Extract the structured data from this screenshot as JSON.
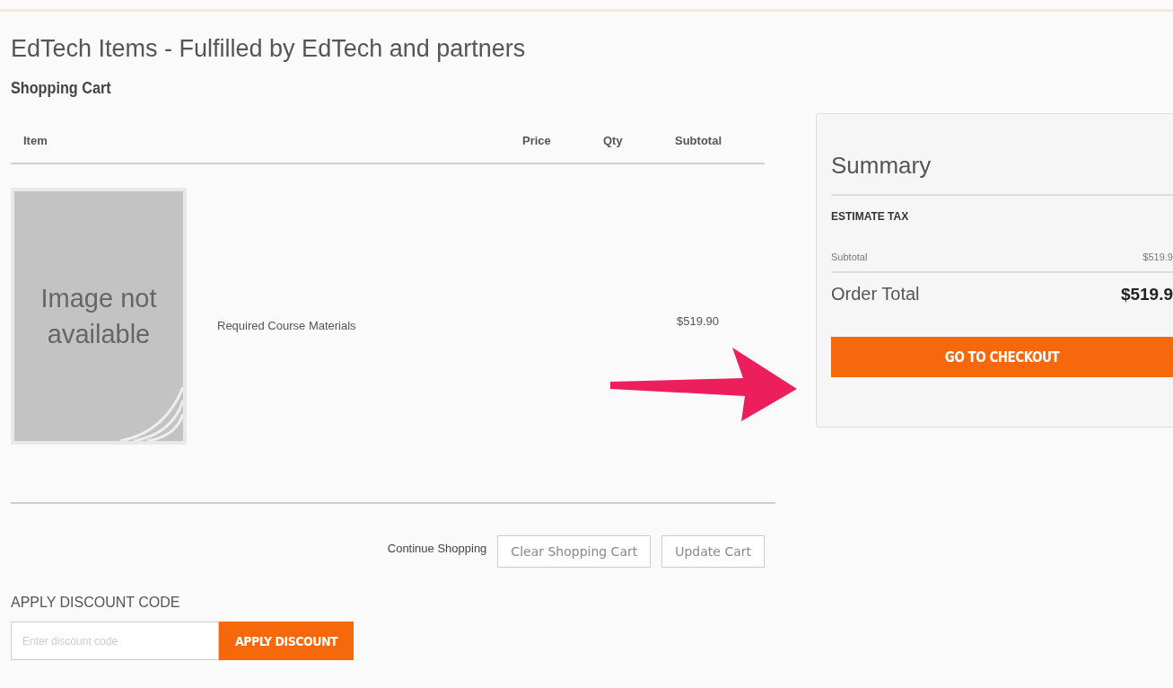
{
  "page": {
    "title": "EdTech Items - Fulfilled by EdTech and partners",
    "subtitle": "Shopping Cart"
  },
  "cart": {
    "columns": [
      "Item",
      "Price",
      "Qty",
      "Subtotal"
    ],
    "rows": [
      {
        "image_text": "Image not available",
        "name": "Required Course Materials",
        "subtotal": "$519.90"
      }
    ]
  },
  "actions": {
    "continue_link": "Continue Shopping",
    "buttons": [
      "Clear Shopping Cart",
      "Update Cart"
    ]
  },
  "discount": {
    "label": "APPLY DISCOUNT CODE",
    "placeholder": "Enter discount code",
    "button": "APPLY DISCOUNT"
  },
  "summary": {
    "title": "Summary",
    "estimate_tax": "ESTIMATE TAX",
    "subtotal_label": "Subtotal",
    "subtotal_value": "$519.9",
    "total_label": "Order Total",
    "total_value": "$519.9",
    "checkout_button": "GO TO CHECKOUT"
  }
}
